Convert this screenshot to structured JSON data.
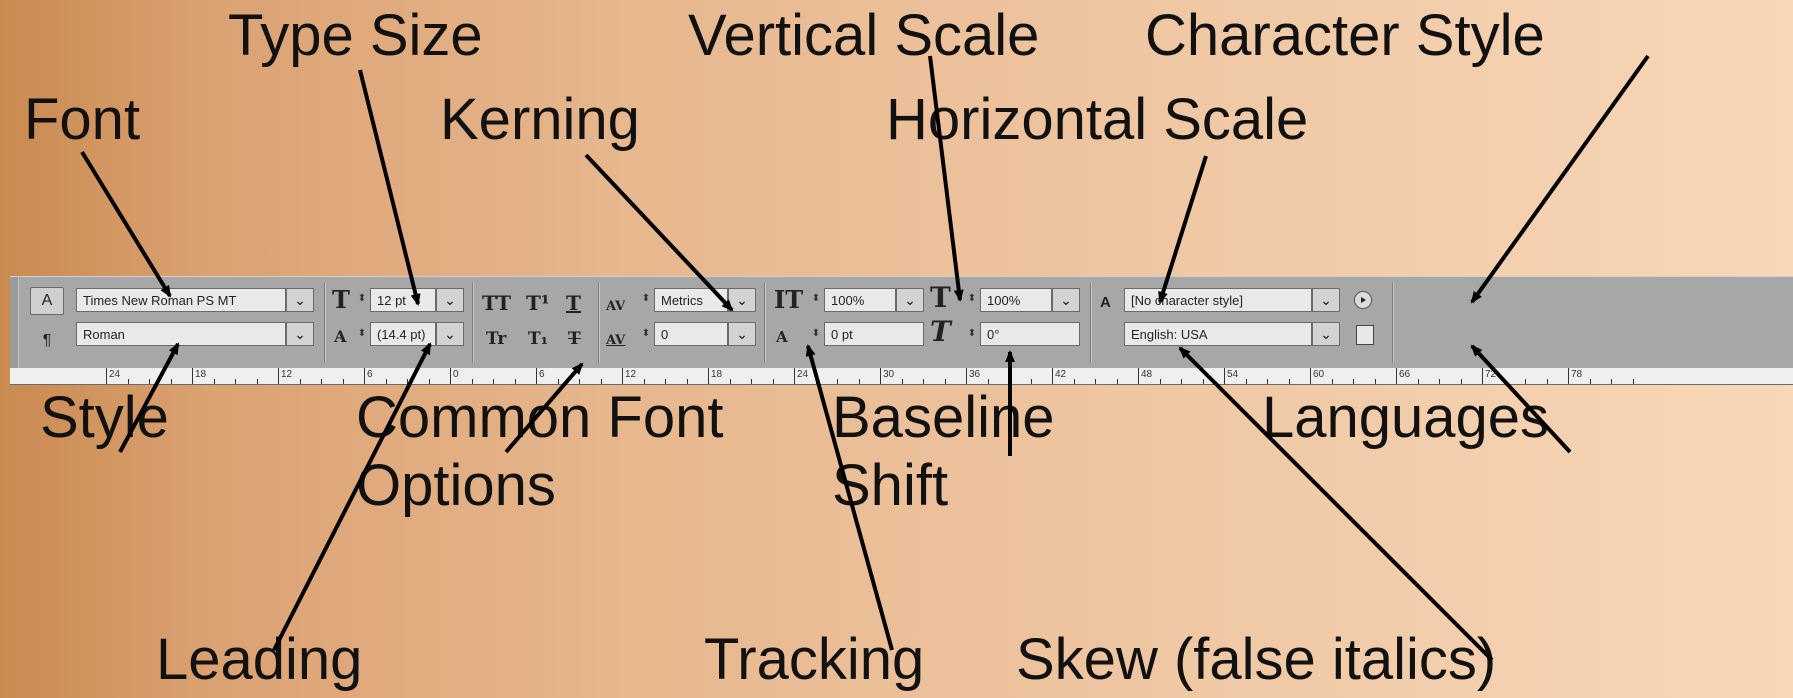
{
  "labels": {
    "type_size": "Type Size",
    "vertical_scale": "Vertical Scale",
    "character_style": "Character Style",
    "font": "Font",
    "kerning": "Kerning",
    "horizontal_scale": "Horizontal Scale",
    "style": "Style",
    "common_font_1": "Common Font",
    "common_font_2": "Options",
    "baseline_1": "Baseline",
    "baseline_2": "Shift",
    "languages": "Languages",
    "leading": "Leading",
    "tracking": "Tracking",
    "skew": "Skew (false italics)"
  },
  "panel": {
    "char_mode_button": "A",
    "para_mode_button": "¶",
    "font_value": "Times New Roman PS MT",
    "style_value": "Roman",
    "size_value": "12 pt",
    "leading_value": "(14.4 pt)",
    "kerning_value": "Metrics",
    "tracking_value": "0",
    "vscale_value": "100%",
    "baseline_value": "0 pt",
    "hscale_value": "100%",
    "skew_value": "0°",
    "char_style_value": "[No character style]",
    "language_value": "English: USA",
    "char_style_icon_glyph": "A"
  },
  "icons": {
    "all_caps": "TT",
    "superscript": "T¹",
    "underline": "T",
    "small_caps": "Tr",
    "subscript": "T₁",
    "strikethrough": "T",
    "size_glyph": "T",
    "leading_glyph": "A",
    "kerning_glyph": "AV",
    "tracking_glyph": "AV",
    "vscale_glyph": "IT",
    "baseline_glyph": "A",
    "hscale_glyph": "T",
    "skew_glyph": "T",
    "dropdown_glyph": "⌄",
    "spin_glyph": "⬍"
  },
  "ruler": [
    "24",
    "18",
    "12",
    "6",
    "0",
    "6",
    "12",
    "18",
    "24",
    "30",
    "36",
    "42",
    "48",
    "54",
    "60",
    "66",
    "72",
    "78"
  ]
}
